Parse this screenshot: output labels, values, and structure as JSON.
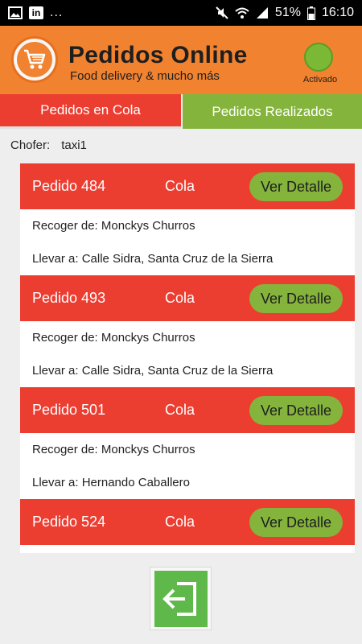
{
  "status_bar": {
    "icons_left": [
      "image-icon",
      "linkedin-icon"
    ],
    "linkedin_glyph": "in",
    "more": "...",
    "battery": "51%",
    "time": "16:10"
  },
  "header": {
    "title": "Pedidos Online",
    "subtitle": "Food delivery & mucho más",
    "status_label": "Activado",
    "status_color": "#7ab835",
    "brand_color": "#f1822f"
  },
  "tabs": [
    {
      "label": "Pedidos en Cola",
      "active": true,
      "color": "#ec3d31"
    },
    {
      "label": "Pedidos Realizados",
      "active": false,
      "color": "#84b43c"
    }
  ],
  "driver": {
    "label": "Chofer:",
    "value": "taxi1"
  },
  "orders": [
    {
      "id": "Pedido 484",
      "status": "Cola",
      "button": "Ver Detalle",
      "pickup": "Recoger de: Monckys Churros",
      "deliver": "Llevar a: Calle Sidra, Santa Cruz de la Sierra"
    },
    {
      "id": "Pedido 493",
      "status": "Cola",
      "button": "Ver Detalle",
      "pickup": "Recoger de: Monckys Churros",
      "deliver": "Llevar a: Calle Sidra, Santa Cruz de la Sierra"
    },
    {
      "id": "Pedido 501",
      "status": "Cola",
      "button": "Ver Detalle",
      "pickup": "Recoger de: Monckys Churros",
      "deliver": "Llevar a: Hernando Caballero"
    },
    {
      "id": "Pedido 524",
      "status": "Cola",
      "button": "Ver Detalle",
      "pickup": "",
      "deliver": ""
    }
  ],
  "exit_icon": "logout-icon"
}
